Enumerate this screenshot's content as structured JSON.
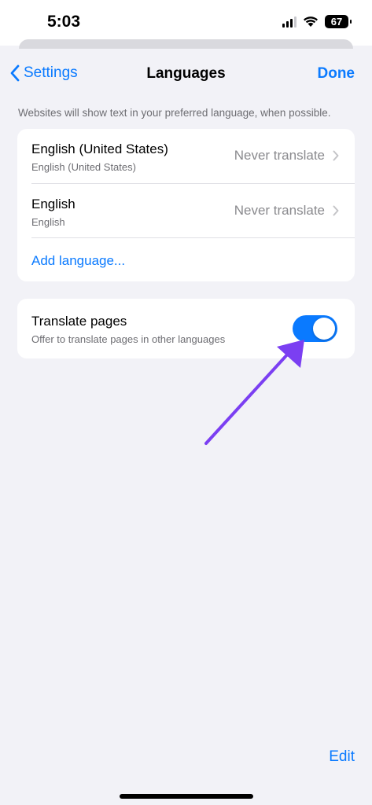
{
  "status_bar": {
    "time": "5:03",
    "battery": "67",
    "icons": [
      "cellular-signal-icon",
      "wifi-icon",
      "battery-icon"
    ]
  },
  "nav": {
    "back_label": "Settings",
    "title": "Languages",
    "done_label": "Done"
  },
  "hint": "Websites will show text in your preferred language, when possible.",
  "languages": [
    {
      "name": "English (United States)",
      "subtitle": "English (United States)",
      "status": "Never translate"
    },
    {
      "name": "English",
      "subtitle": "English",
      "status": "Never translate"
    }
  ],
  "add_language_label": "Add language...",
  "translate": {
    "title": "Translate pages",
    "subtitle": "Offer to translate pages in other languages",
    "enabled": true
  },
  "edit_label": "Edit",
  "colors": {
    "accent": "#0a7aff",
    "background": "#f2f2f7",
    "annotation_arrow": "#7b3ff2"
  }
}
